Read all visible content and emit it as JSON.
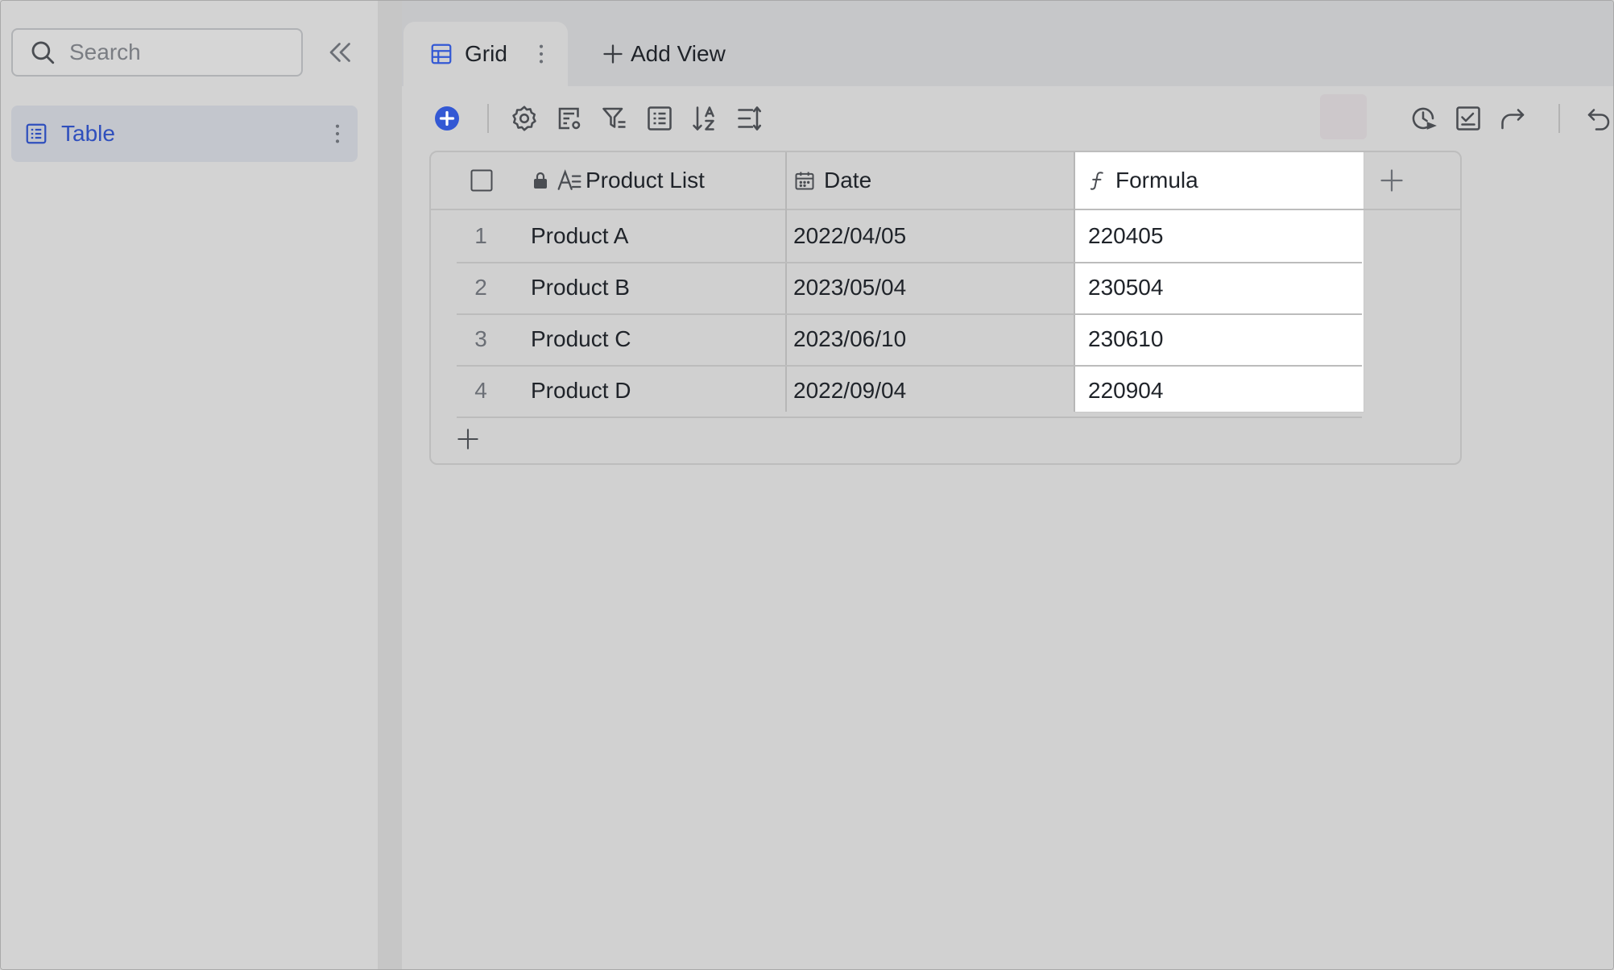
{
  "sidebar": {
    "search_placeholder": "Search",
    "items": [
      {
        "label": "Table",
        "icon": "table-icon"
      }
    ]
  },
  "tabs": {
    "active": {
      "label": "Grid",
      "icon": "grid-icon"
    },
    "add_view_label": "Add View"
  },
  "toolbar": {
    "icons": [
      "add-record-icon",
      "settings-icon",
      "field-settings-icon",
      "filter-icon",
      "group-icon",
      "sort-icon",
      "row-height-icon",
      "history-icon",
      "task-icon",
      "share-icon",
      "undo-icon"
    ],
    "accent": "#3358d4"
  },
  "grid": {
    "columns": [
      {
        "label": "Product List",
        "icon": "text-field-icon",
        "locked": true
      },
      {
        "label": "Date",
        "icon": "calendar-icon"
      },
      {
        "label": "Formula",
        "icon": "formula-icon"
      }
    ],
    "rows": [
      {
        "num": "1",
        "product": "Product A",
        "date": "2022/04/05",
        "formula": "220405"
      },
      {
        "num": "2",
        "product": "Product B",
        "date": "2023/05/04",
        "formula": "230504"
      },
      {
        "num": "3",
        "product": "Product C",
        "date": "2023/06/10",
        "formula": "230610"
      },
      {
        "num": "4",
        "product": "Product D",
        "date": "2022/09/04",
        "formula": "220904"
      }
    ]
  }
}
